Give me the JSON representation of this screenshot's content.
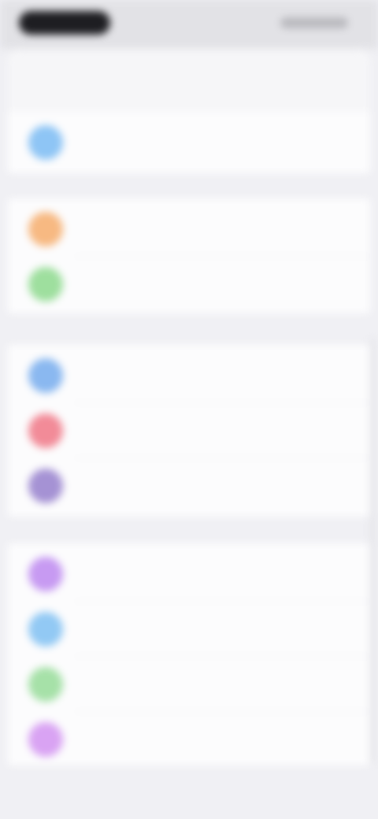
{
  "status_bar": {
    "time_label": "",
    "indicators_label": ""
  },
  "nav": {
    "back_label": "",
    "title": "",
    "action_label": ""
  },
  "colors": {
    "background": "#f0f0f4",
    "blue": "#8ec5f5",
    "orange": "#f7b982",
    "green": "#9edf9e",
    "blue2": "#8ab8f0",
    "red": "#f28b98",
    "purple": "#a592d4",
    "violet": "#c79af2",
    "light_blue": "#92c9f4",
    "mint": "#a6e1a8",
    "pink_violet": "#d9a3f3"
  },
  "groups": [
    {
      "rows": [
        {
          "icon": "circle-icon",
          "color": "#8ec5f5",
          "label": "",
          "value": ""
        }
      ]
    },
    {
      "rows": [
        {
          "icon": "circle-icon",
          "color": "#f7b982",
          "label": "",
          "value": ""
        },
        {
          "icon": "circle-icon",
          "color": "#9edf9e",
          "label": "",
          "value": ""
        }
      ]
    },
    {
      "rows": [
        {
          "icon": "circle-icon",
          "color": "#8ab8f0",
          "label": "",
          "value": ""
        },
        {
          "icon": "circle-icon",
          "color": "#f28b98",
          "label": "",
          "value": ""
        },
        {
          "icon": "circle-icon",
          "color": "#a592d4",
          "label": "",
          "value": ""
        }
      ]
    },
    {
      "rows": [
        {
          "icon": "circle-icon",
          "color": "#c79af2",
          "label": "",
          "value": ""
        },
        {
          "icon": "circle-icon",
          "color": "#92c9f4",
          "label": "",
          "value": ""
        },
        {
          "icon": "circle-icon",
          "color": "#a6e1a8",
          "label": "",
          "value": ""
        },
        {
          "icon": "circle-icon",
          "color": "#d9a3f3",
          "label": "",
          "value": ""
        }
      ]
    }
  ]
}
